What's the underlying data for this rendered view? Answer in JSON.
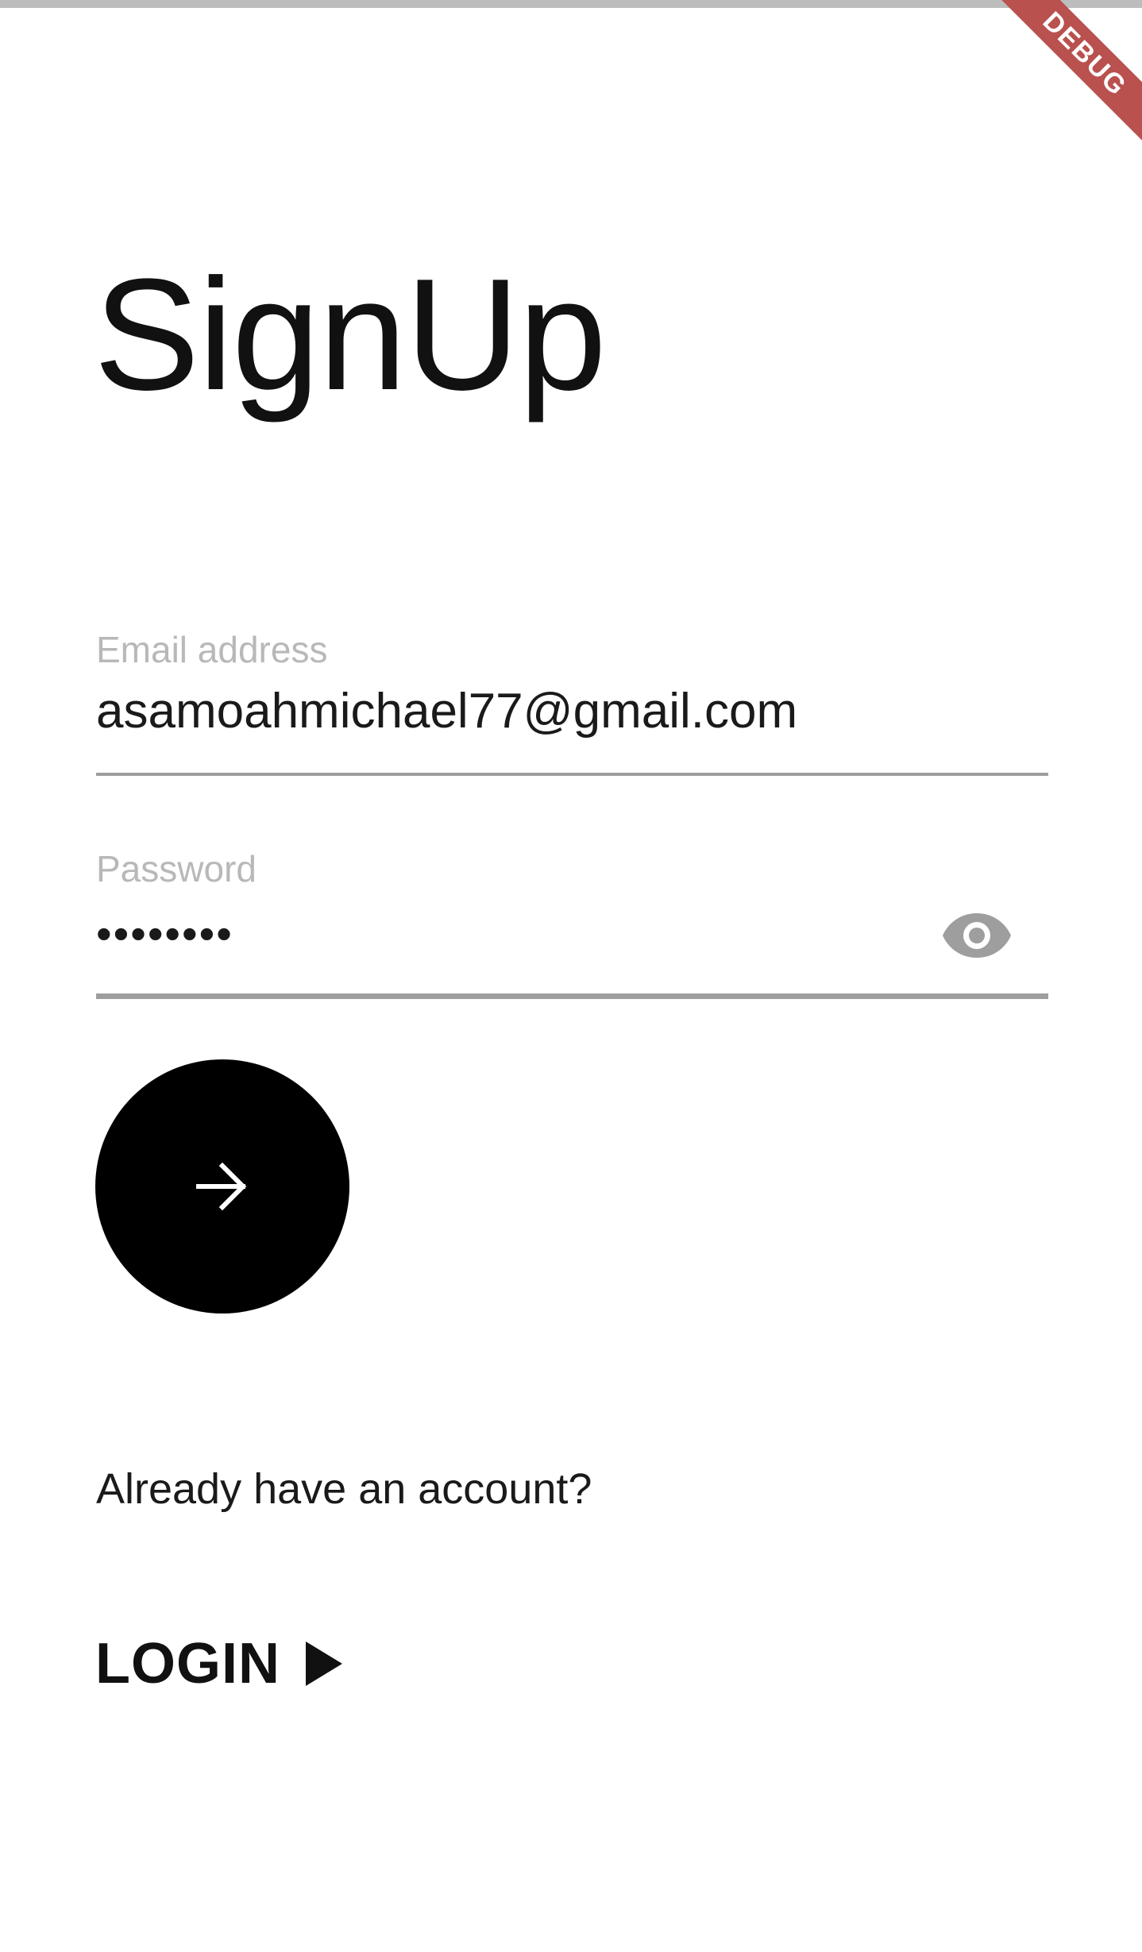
{
  "debug_banner": {
    "label": "DEBUG"
  },
  "page": {
    "title": "SignUp"
  },
  "email": {
    "label": "Email address",
    "value": "asamoahmichael77@gmail.com"
  },
  "password": {
    "label": "Password",
    "value": "••••••••",
    "toggle_icon": "eye-icon"
  },
  "submit": {
    "icon": "arrow-right-icon"
  },
  "account_prompt": {
    "text": "Already have an account?"
  },
  "login": {
    "label": "LOGIN",
    "icon": "play-triangle-icon"
  },
  "colors": {
    "accent": "#000000",
    "label_gray": "#b8b8b8",
    "underline_gray": "#9e9e9e",
    "debug_ribbon": "#b9514f"
  }
}
